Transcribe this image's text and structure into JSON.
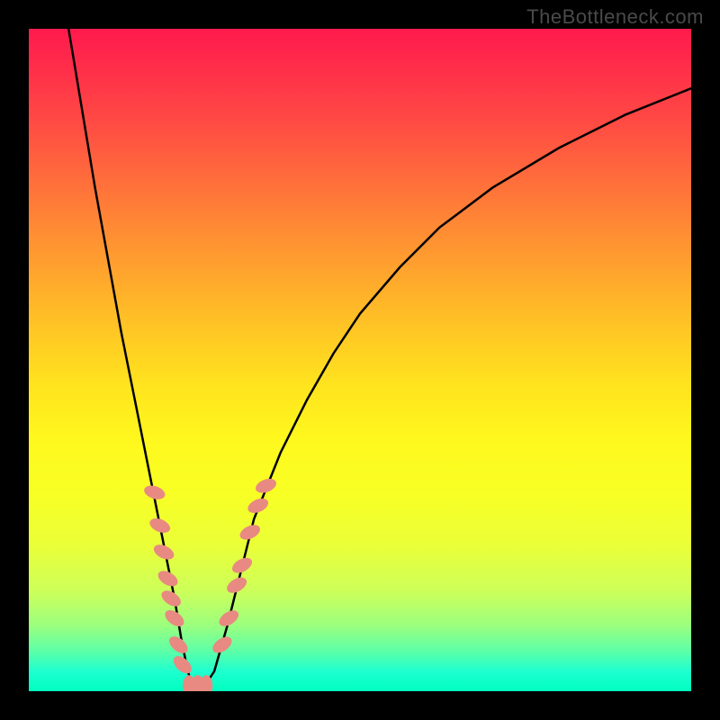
{
  "watermark": "TheBottleneck.com",
  "chart_data": {
    "type": "line",
    "title": "",
    "xlabel": "",
    "ylabel": "",
    "xlim": [
      0,
      100
    ],
    "ylim": [
      0,
      100
    ],
    "series": [
      {
        "name": "bottleneck-curve",
        "x": [
          6,
          8,
          10,
          12,
          14,
          16,
          18,
          20,
          22,
          23,
          24,
          25,
          26,
          28,
          30,
          32,
          34,
          38,
          42,
          46,
          50,
          56,
          62,
          70,
          80,
          90,
          100
        ],
        "y": [
          100,
          88,
          76,
          65,
          54,
          44,
          34,
          24,
          14,
          8,
          3,
          0,
          0,
          3,
          10,
          18,
          26,
          36,
          44,
          51,
          57,
          64,
          70,
          76,
          82,
          87,
          91
        ]
      }
    ],
    "markers": {
      "name": "highlighted-points",
      "color": "#e88a82",
      "points": [
        {
          "x": 19.0,
          "y": 30
        },
        {
          "x": 19.8,
          "y": 25
        },
        {
          "x": 20.4,
          "y": 21
        },
        {
          "x": 21.0,
          "y": 17
        },
        {
          "x": 21.5,
          "y": 14
        },
        {
          "x": 22.0,
          "y": 11
        },
        {
          "x": 22.6,
          "y": 7
        },
        {
          "x": 23.2,
          "y": 4
        },
        {
          "x": 24.2,
          "y": 0.8
        },
        {
          "x": 25.5,
          "y": 0.8
        },
        {
          "x": 26.8,
          "y": 0.8
        },
        {
          "x": 29.2,
          "y": 7
        },
        {
          "x": 30.2,
          "y": 11
        },
        {
          "x": 31.4,
          "y": 16
        },
        {
          "x": 32.2,
          "y": 19
        },
        {
          "x": 33.4,
          "y": 24
        },
        {
          "x": 34.6,
          "y": 28
        },
        {
          "x": 35.8,
          "y": 31
        }
      ]
    },
    "gradient_zones": [
      {
        "y": 100,
        "color": "#ff1a4d"
      },
      {
        "y": 50,
        "color": "#ffe41e"
      },
      {
        "y": 0,
        "color": "#00ffc0"
      }
    ]
  }
}
